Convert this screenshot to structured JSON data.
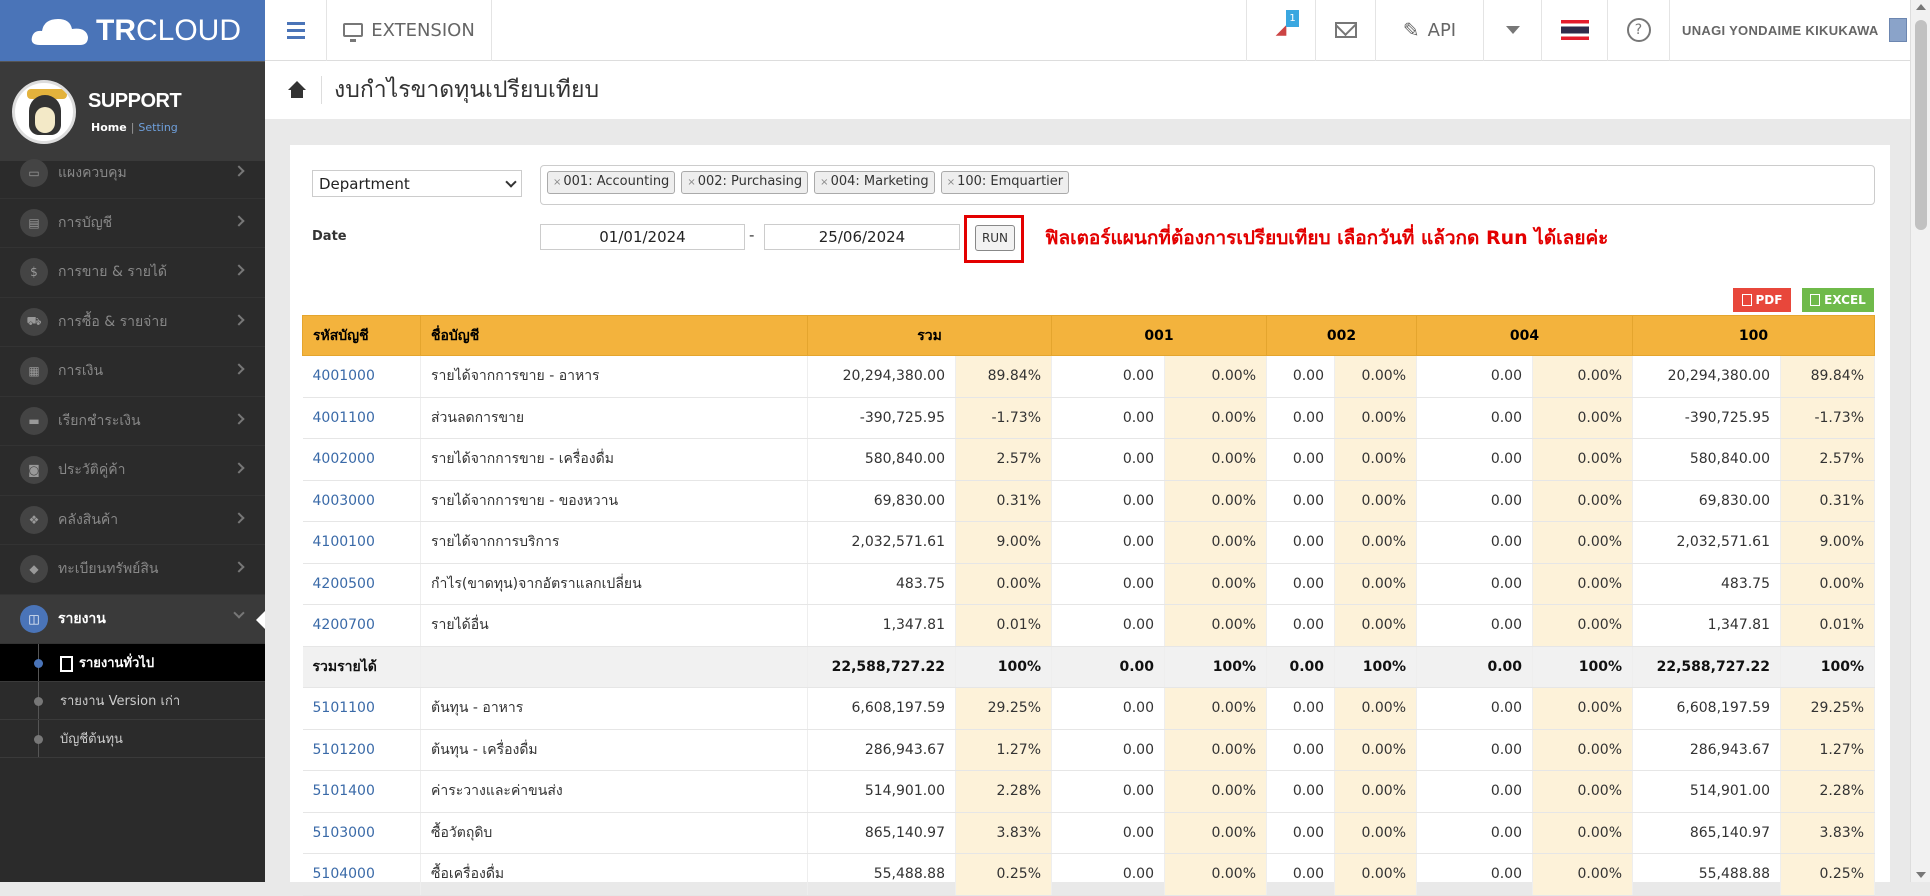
{
  "brand": {
    "logo_bold": "TR",
    "logo_rest": "CLOUD"
  },
  "profile": {
    "name": "SUPPORT",
    "home": "Home",
    "sep": "|",
    "setting": "Setting"
  },
  "nav": [
    {
      "label": "แผงควบคุม",
      "icon": "monitor-icon",
      "glyph": "▭"
    },
    {
      "label": "การบัญชี",
      "icon": "book-icon",
      "glyph": "▤"
    },
    {
      "label": "การขาย & รายได้",
      "icon": "dollar-icon",
      "glyph": "$"
    },
    {
      "label": "การซื้อ & รายจ่าย",
      "icon": "cart-icon",
      "glyph": "⛟"
    },
    {
      "label": "การเงิน",
      "icon": "calendar-icon",
      "glyph": "▦"
    },
    {
      "label": "เรียกชำระเงิน",
      "icon": "card-icon",
      "glyph": "▬"
    },
    {
      "label": "ประวัติคู่ค้า",
      "icon": "contact-icon",
      "glyph": "◙"
    },
    {
      "label": "คลังสินค้า",
      "icon": "boxes-icon",
      "glyph": "❖"
    },
    {
      "label": "ทะเบียนทรัพย์สิน",
      "icon": "diamond-icon",
      "glyph": "◆"
    },
    {
      "label": "รายงาน",
      "icon": "report-icon",
      "glyph": "◫"
    }
  ],
  "subnav": [
    {
      "label": "รายงานทั่วไป"
    },
    {
      "label": "รายงาน Version เก่า"
    },
    {
      "label": "บัญชีต้นทุน"
    }
  ],
  "topbar": {
    "extension": "EXTENSION",
    "badge": "1",
    "api": "API",
    "user": "UNAGI YONDAIME KIKUKAWA",
    "help": "?"
  },
  "page": {
    "title": "งบกำไรขาดทุนเปรียบเทียบ"
  },
  "filter": {
    "select": "Department",
    "tags": [
      "001: Accounting",
      "002: Purchasing",
      "004: Marketing",
      "100: Emquartier"
    ],
    "date_label": "Date",
    "date_from": "01/01/2024",
    "date_dash": "-",
    "date_to": "25/06/2024",
    "run": "RUN",
    "annotation": "ฟิลเตอร์แผนกที่ต้องการเปรียบเทียบ เลือกวันที่ แล้วกด Run ได้เลยค่ะ"
  },
  "export": {
    "pdf": "PDF",
    "excel": "EXCEL"
  },
  "table": {
    "headers": [
      "รหัสบัญชี",
      "ชื่อบัญชี",
      "รวม",
      "001",
      "002",
      "004",
      "100"
    ],
    "rows": [
      {
        "code": "4001000",
        "name": "รายได้จากการขาย - อาหาร",
        "vals": [
          "20,294,380.00",
          "89.84%",
          "0.00",
          "0.00%",
          "0.00",
          "0.00%",
          "0.00",
          "0.00%",
          "20,294,380.00",
          "89.84%"
        ]
      },
      {
        "code": "4001100",
        "name": "ส่วนลดการขาย",
        "vals": [
          "-390,725.95",
          "-1.73%",
          "0.00",
          "0.00%",
          "0.00",
          "0.00%",
          "0.00",
          "0.00%",
          "-390,725.95",
          "-1.73%"
        ]
      },
      {
        "code": "4002000",
        "name": "รายได้จากการขาย - เครื่องดื่ม",
        "vals": [
          "580,840.00",
          "2.57%",
          "0.00",
          "0.00%",
          "0.00",
          "0.00%",
          "0.00",
          "0.00%",
          "580,840.00",
          "2.57%"
        ]
      },
      {
        "code": "4003000",
        "name": "รายได้จากการขาย - ของหวาน",
        "vals": [
          "69,830.00",
          "0.31%",
          "0.00",
          "0.00%",
          "0.00",
          "0.00%",
          "0.00",
          "0.00%",
          "69,830.00",
          "0.31%"
        ]
      },
      {
        "code": "4100100",
        "name": "รายได้จากการบริการ",
        "vals": [
          "2,032,571.61",
          "9.00%",
          "0.00",
          "0.00%",
          "0.00",
          "0.00%",
          "0.00",
          "0.00%",
          "2,032,571.61",
          "9.00%"
        ]
      },
      {
        "code": "4200500",
        "name": "กำไร(ขาดทุน)จากอัตราแลกเปลี่ยน",
        "vals": [
          "483.75",
          "0.00%",
          "0.00",
          "0.00%",
          "0.00",
          "0.00%",
          "0.00",
          "0.00%",
          "483.75",
          "0.00%"
        ]
      },
      {
        "code": "4200700",
        "name": "รายได้อื่น",
        "vals": [
          "1,347.81",
          "0.01%",
          "0.00",
          "0.00%",
          "0.00",
          "0.00%",
          "0.00",
          "0.00%",
          "1,347.81",
          "0.01%"
        ]
      },
      {
        "total": true,
        "code": "รวมรายได้",
        "name": "",
        "vals": [
          "22,588,727.22",
          "100%",
          "0.00",
          "100%",
          "0.00",
          "100%",
          "0.00",
          "100%",
          "22,588,727.22",
          "100%"
        ]
      },
      {
        "code": "5101100",
        "name": "ต้นทุน - อาหาร",
        "vals": [
          "6,608,197.59",
          "29.25%",
          "0.00",
          "0.00%",
          "0.00",
          "0.00%",
          "0.00",
          "0.00%",
          "6,608,197.59",
          "29.25%"
        ]
      },
      {
        "code": "5101200",
        "name": "ต้นทุน - เครื่องดื่ม",
        "vals": [
          "286,943.67",
          "1.27%",
          "0.00",
          "0.00%",
          "0.00",
          "0.00%",
          "0.00",
          "0.00%",
          "286,943.67",
          "1.27%"
        ]
      },
      {
        "code": "5101400",
        "name": "ค่าระวางและค่าขนส่ง",
        "vals": [
          "514,901.00",
          "2.28%",
          "0.00",
          "0.00%",
          "0.00",
          "0.00%",
          "0.00",
          "0.00%",
          "514,901.00",
          "2.28%"
        ]
      },
      {
        "code": "5103000",
        "name": "ซื้อวัตถุดิบ",
        "vals": [
          "865,140.97",
          "3.83%",
          "0.00",
          "0.00%",
          "0.00",
          "0.00%",
          "0.00",
          "0.00%",
          "865,140.97",
          "3.83%"
        ]
      },
      {
        "code": "5104000",
        "name": "ซื้อเครื่องดื่ม",
        "vals": [
          "55,488.88",
          "0.25%",
          "0.00",
          "0.00%",
          "0.00",
          "0.00%",
          "0.00",
          "0.00%",
          "55,488.88",
          "0.25%"
        ]
      }
    ]
  }
}
